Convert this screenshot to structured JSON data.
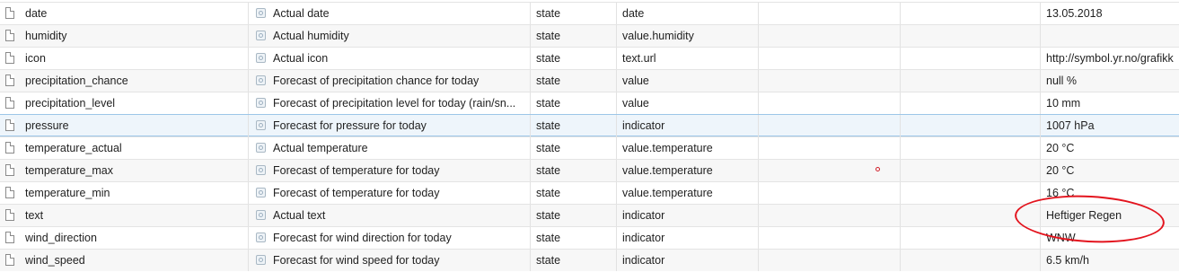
{
  "rows": [
    {
      "name": "date",
      "desc": "Actual date",
      "role": "state",
      "type": "date",
      "value": "13.05.2018"
    },
    {
      "name": "humidity",
      "desc": "Actual humidity",
      "role": "state",
      "type": "value.humidity",
      "value": ""
    },
    {
      "name": "icon",
      "desc": "Actual icon",
      "role": "state",
      "type": "text.url",
      "value": "http://symbol.yr.no/grafikk"
    },
    {
      "name": "precipitation_chance",
      "desc": "Forecast of precipitation chance for today",
      "role": "state",
      "type": "value",
      "value": "null %"
    },
    {
      "name": "precipitation_level",
      "desc": "Forecast of precipitation level for today (rain/sn...",
      "role": "state",
      "type": "value",
      "value": "10 mm"
    },
    {
      "name": "pressure",
      "desc": "Forecast for pressure for today",
      "role": "state",
      "type": "indicator",
      "value": "1007 hPa"
    },
    {
      "name": "temperature_actual",
      "desc": "Actual temperature",
      "role": "state",
      "type": "value.temperature",
      "value": "20 °C"
    },
    {
      "name": "temperature_max",
      "desc": "Forecast of temperature for today",
      "role": "state",
      "type": "value.temperature",
      "value": "20 °C"
    },
    {
      "name": "temperature_min",
      "desc": "Forecast of temperature for today",
      "role": "state",
      "type": "value.temperature",
      "value": "16 °C"
    },
    {
      "name": "text",
      "desc": "Actual text",
      "role": "state",
      "type": "indicator",
      "value": "Heftiger Regen"
    },
    {
      "name": "wind_direction",
      "desc": "Forecast for wind direction for today",
      "role": "state",
      "type": "indicator",
      "value": "WNW"
    },
    {
      "name": "wind_speed",
      "desc": "Forecast for wind speed for today",
      "role": "state",
      "type": "indicator",
      "value": "6.5 km/h"
    }
  ],
  "selected_row": "pressure",
  "annotation_color": "#e3141e"
}
